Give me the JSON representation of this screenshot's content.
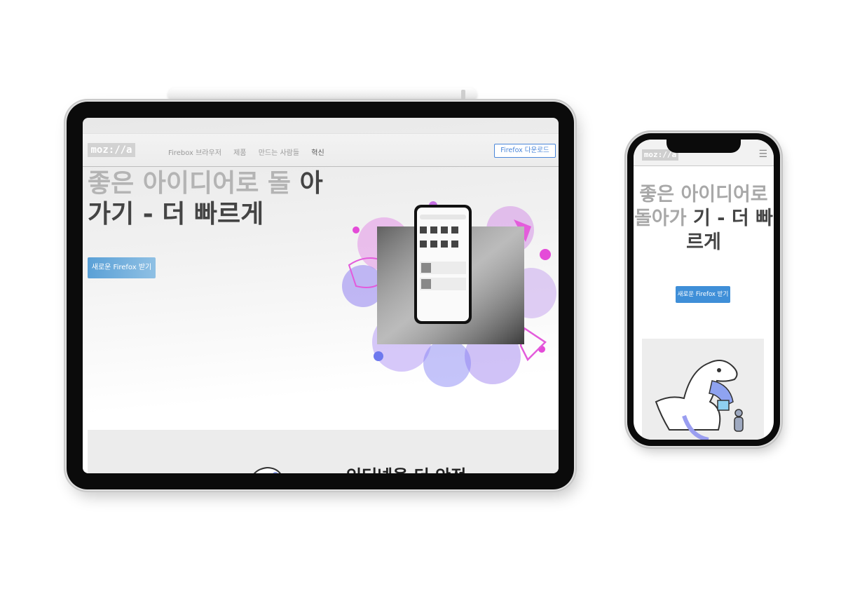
{
  "tablet": {
    "logo": "moz://a",
    "nav": {
      "links": [
        "Firebox 브라우저",
        "제품",
        "만드는 사람들",
        "혁신"
      ],
      "download_label": "Firefox 다운로드"
    },
    "hero": {
      "heading_light": "좋은 아이디어로 돌",
      "heading_dark": "아가기 - 더 빠르게",
      "cta_label": "새로운 Firefox 받기"
    },
    "section_heading": "인터넷을 더 안전"
  },
  "phone": {
    "logo": "moz://a",
    "menu_icon": "hamburger-icon",
    "hero": {
      "heading_light": "좋은 아이디어로 돌아가",
      "heading_dark": "기 - 더 빠르게",
      "cta_label": "새로운 Firefox 받기"
    }
  },
  "colors": {
    "accent": "#4a86d9",
    "cta": "#3f8fd8",
    "heading_dark": "#444444",
    "heading_light": "#b4b4b4"
  }
}
